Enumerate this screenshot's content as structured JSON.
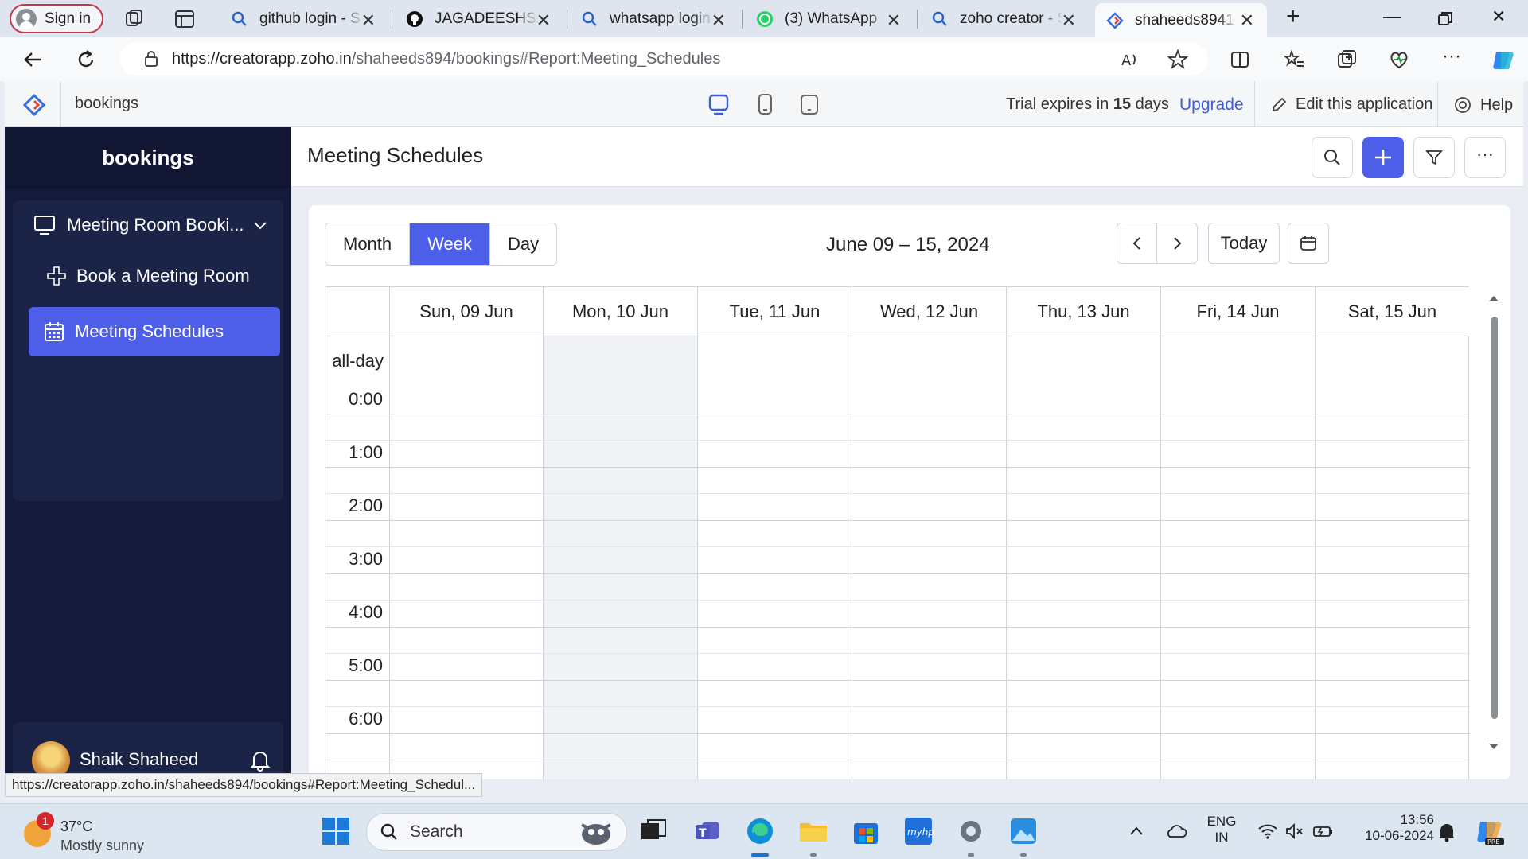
{
  "browser": {
    "sign_in": "Sign in",
    "tabs": [
      {
        "title": "github login - S",
        "icon": "search-icon"
      },
      {
        "title": "JAGADEESHSA/",
        "icon": "github-icon"
      },
      {
        "title": "whatsapp login",
        "icon": "search-icon"
      },
      {
        "title": "(3) WhatsApp",
        "icon": "whatsapp-icon"
      },
      {
        "title": "zoho creator - S",
        "icon": "search-icon"
      },
      {
        "title": "shaheeds8941",
        "icon": "zoho-icon",
        "active": true
      }
    ],
    "url_host": "https://creatorapp.zoho.in",
    "url_path": "/shaheeds894/bookings#Report:Meeting_Schedules"
  },
  "zoho_bar": {
    "app_name": "bookings",
    "trial_prefix": "Trial expires in ",
    "trial_days": "15",
    "trial_suffix": " days",
    "upgrade": "Upgrade",
    "edit_app": "Edit this application",
    "help": "Help"
  },
  "sidebar": {
    "title": "bookings",
    "group_label": "Meeting Room Booki...",
    "items": [
      {
        "label": "Book a Meeting Room",
        "icon": "plus-icon"
      },
      {
        "label": "Meeting Schedules",
        "icon": "calendar-icon",
        "active": true
      }
    ],
    "user_name": "Shaik Shaheed"
  },
  "main": {
    "page_title": "Meeting Schedules",
    "views": [
      "Month",
      "Week",
      "Day"
    ],
    "active_view": "Week",
    "range": "June 09 – 15, 2024",
    "today": "Today",
    "days": [
      "Sun, 09 Jun",
      "Mon, 10 Jun",
      "Tue, 11 Jun",
      "Wed, 12 Jun",
      "Thu, 13 Jun",
      "Fri, 14 Jun",
      "Sat, 15 Jun"
    ],
    "all_day": "all-day",
    "times": [
      "0:00",
      "1:00",
      "2:00",
      "3:00",
      "4:00",
      "5:00",
      "6:00"
    ]
  },
  "status_url": "https://creatorapp.zoho.in/shaheeds894/bookings#Report:Meeting_Schedul...",
  "taskbar": {
    "weather_badge": "1",
    "temperature": "37°C",
    "condition": "Mostly sunny",
    "search": "Search",
    "lang1": "ENG",
    "lang2": "IN",
    "time": "13:56",
    "date": "10-06-2024"
  },
  "colors": {
    "accent": "#4d5ee8",
    "sidebar_bg": "#141b3a",
    "upgrade_link": "#3d5dd8"
  }
}
